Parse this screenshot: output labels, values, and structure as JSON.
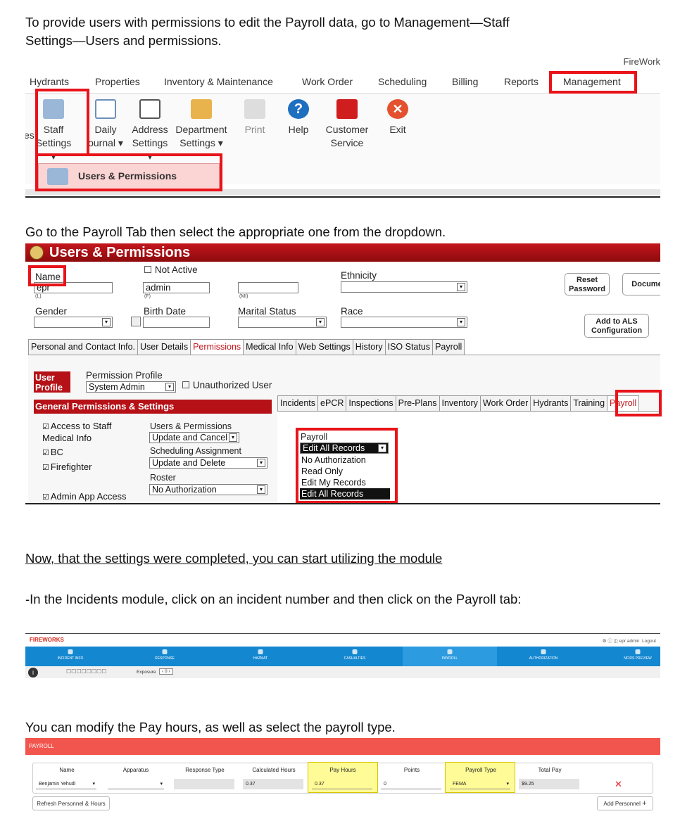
{
  "instructions": {
    "p1": "To provide users with permissions to edit the Payroll data, go to Management—Staff",
    "p1b": "Settings—Users and permissions.",
    "p2": "Go to the Payroll Tab then select the appropriate one from the dropdown.",
    "p3": "Now, that the settings were completed, you can start utilizing the module",
    "p4": "-In the Incidents module, click on an incident number and then click on the Payroll tab:",
    "p5": "You can modify the Pay hours, as well as select the payroll type."
  },
  "ribbon": {
    "brand": "FireWork",
    "menu": [
      "Hydrants",
      "Properties",
      "Inventory & Maintenance",
      "Work Order",
      "Scheduling",
      "Billing",
      "Reports",
      "Management"
    ],
    "tools": [
      {
        "l1": "es",
        "l2": ""
      },
      {
        "l1": "Staff",
        "l2": "Settings ▾"
      },
      {
        "l1": "Daily",
        "l2": "ournal ▾"
      },
      {
        "l1": "Address",
        "l2": "Settings ▾"
      },
      {
        "l1": "Department",
        "l2": "Settings ▾"
      },
      {
        "l1": "Print",
        "l2": ""
      },
      {
        "l1": "Help",
        "l2": ""
      },
      {
        "l1": "Customer",
        "l2": "Service"
      },
      {
        "l1": "Exit",
        "l2": ""
      }
    ],
    "dropdown_item": "Users & Permissions"
  },
  "users_permissions": {
    "title": "Users & Permissions",
    "not_active": "Not Active",
    "name_label": "Name",
    "last_value": "epr",
    "first_value": "admin",
    "sub_l": "(L)",
    "sub_f": "(F)",
    "sub_mi": "(MI)",
    "ethnicity": "Ethnicity",
    "gender": "Gender",
    "birth_date": "Birth Date",
    "marital_status": "Marital Status",
    "race": "Race",
    "reset_password": "Reset Password",
    "documents": "Docume",
    "add_als": "Add to ALS Configuration",
    "tabs": [
      "Personal and Contact Info.",
      "User Details",
      "Permissions",
      "Medical Info",
      "Web Settings",
      "History",
      "ISO Status",
      "Payroll"
    ],
    "user_profile": "User Profile",
    "permission_profile": "Permission Profile",
    "profile_value": "System Admin",
    "unauthorized_user": "Unauthorized User",
    "general_permissions": "General Permissions & Settings",
    "checks": [
      "Access to Staff Medical Info",
      "BC",
      "Firefighter",
      "Admin App Access"
    ],
    "perm_users_label": "Users & Permissions",
    "perm_users_value": "Update and Cancel",
    "perm_sched_label": "Scheduling Assignment",
    "perm_sched_value": "Update and Delete",
    "perm_roster_label": "Roster",
    "perm_roster_value": "No Authorization",
    "module_tabs": [
      "Incidents",
      "ePCR",
      "Inspections",
      "Pre-Plans",
      "Inventory",
      "Work Order",
      "Hydrants",
      "Training",
      "Payroll"
    ],
    "payroll_label": "Payroll",
    "payroll_selected": "Edit All Records",
    "payroll_options": [
      "No Authorization",
      "Read Only",
      "Edit My Records",
      "Edit All Records"
    ]
  },
  "fireworks": {
    "logo": "FIREWORKS",
    "user": "epr admin",
    "logout": "Logout",
    "nav": [
      "INCIDENT INFO",
      "RESPONSE",
      "HAZMAT",
      "CASUALTIES",
      "PAYROLL",
      "AUTHORIZATION",
      "NFIRS PREVIEW"
    ],
    "exposure_label": "Exposure",
    "exposure_value": "0"
  },
  "payroll": {
    "header": "PAYROLL",
    "columns": [
      "Name",
      "Apparatus",
      "Response Type",
      "Calculated Hours",
      "Pay Hours",
      "Points",
      "Payroll Type",
      "Total Pay"
    ],
    "row": {
      "name": "Benjamin Yehudi",
      "apparatus": "",
      "response_type": "",
      "calculated_hours": "0.37",
      "pay_hours": "0.37",
      "points": "0",
      "payroll_type": "FEMA",
      "total_pay": "$9.25"
    },
    "refresh_button": "Refresh Personnel & Hours",
    "add_button": "Add Personnel"
  },
  "colors": {
    "highlight_box": "#e8141a",
    "app_red": "#b51117",
    "nav_blue": "#1487d1",
    "payroll_header": "#f2554d",
    "yellow_highlight": "#fffb96"
  }
}
